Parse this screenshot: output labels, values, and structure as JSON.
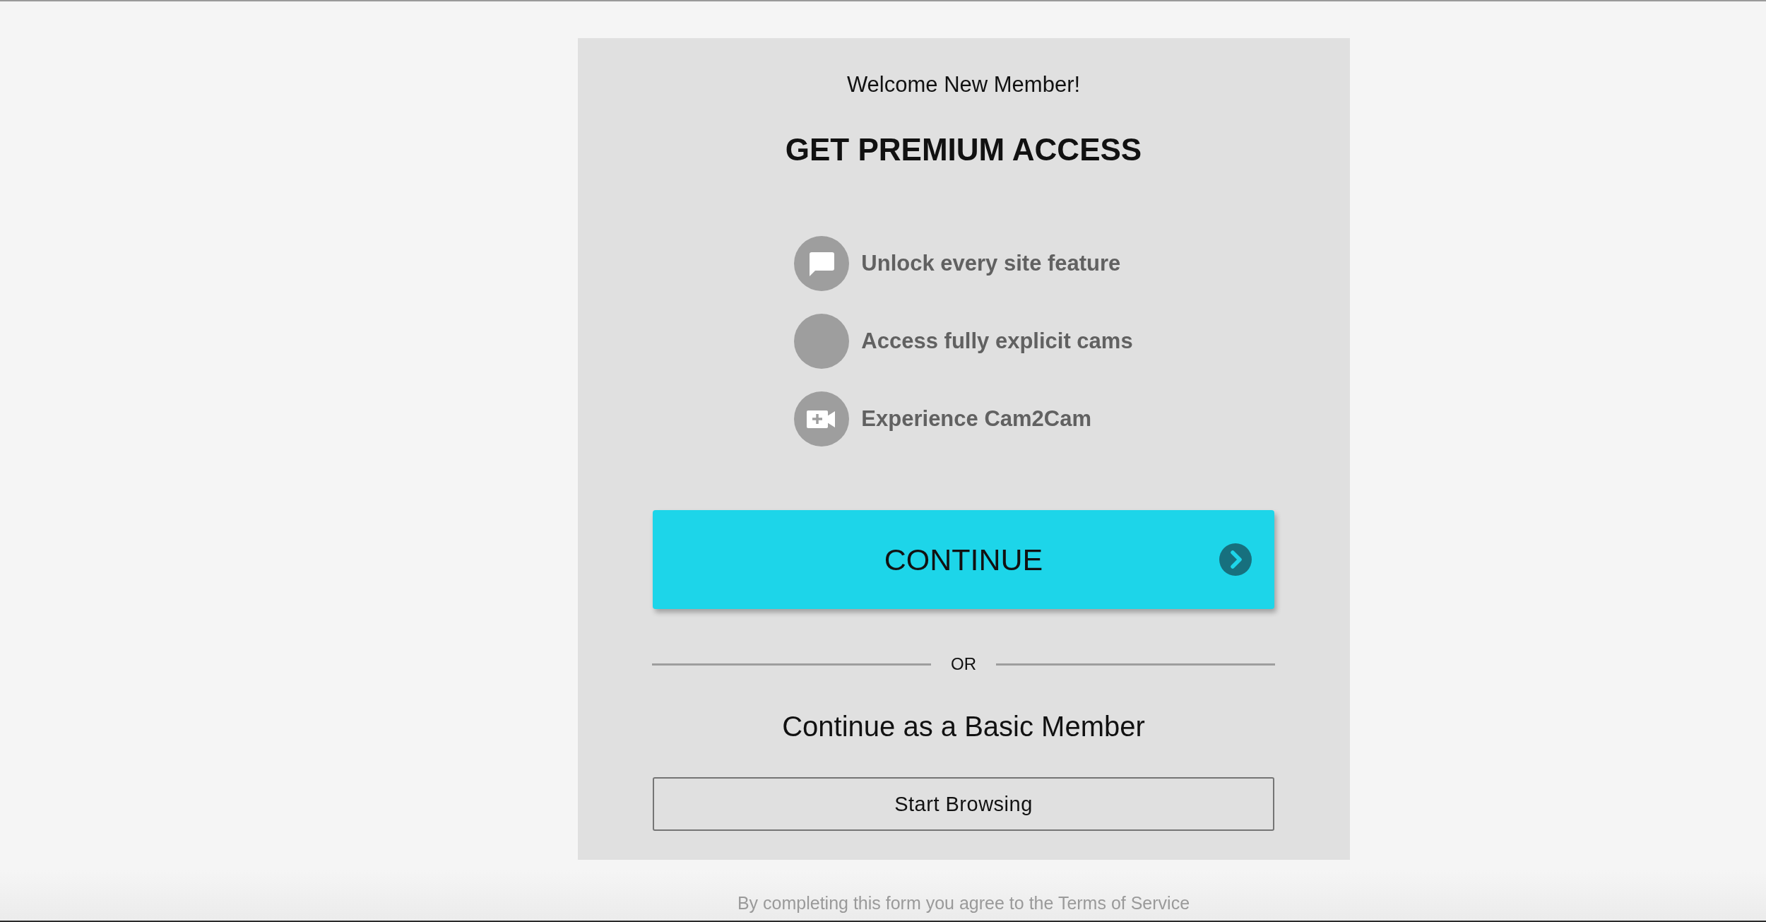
{
  "card": {
    "welcome": "Welcome New Member!",
    "title": "GET PREMIUM ACCESS",
    "features": [
      {
        "kind": "chat",
        "label": "Unlock every site feature"
      },
      {
        "kind": "blank",
        "label": "Access fully explicit cams"
      },
      {
        "kind": "video",
        "label": "Experience Cam2Cam"
      }
    ],
    "continue_button": {
      "label": "CONTINUE"
    },
    "divider": {
      "label": "OR"
    },
    "basic_member": {
      "heading": "Continue as a Basic Member",
      "button": "Start Browsing"
    }
  },
  "footer": {
    "text": "By completing this form you agree to the Terms of Service"
  }
}
